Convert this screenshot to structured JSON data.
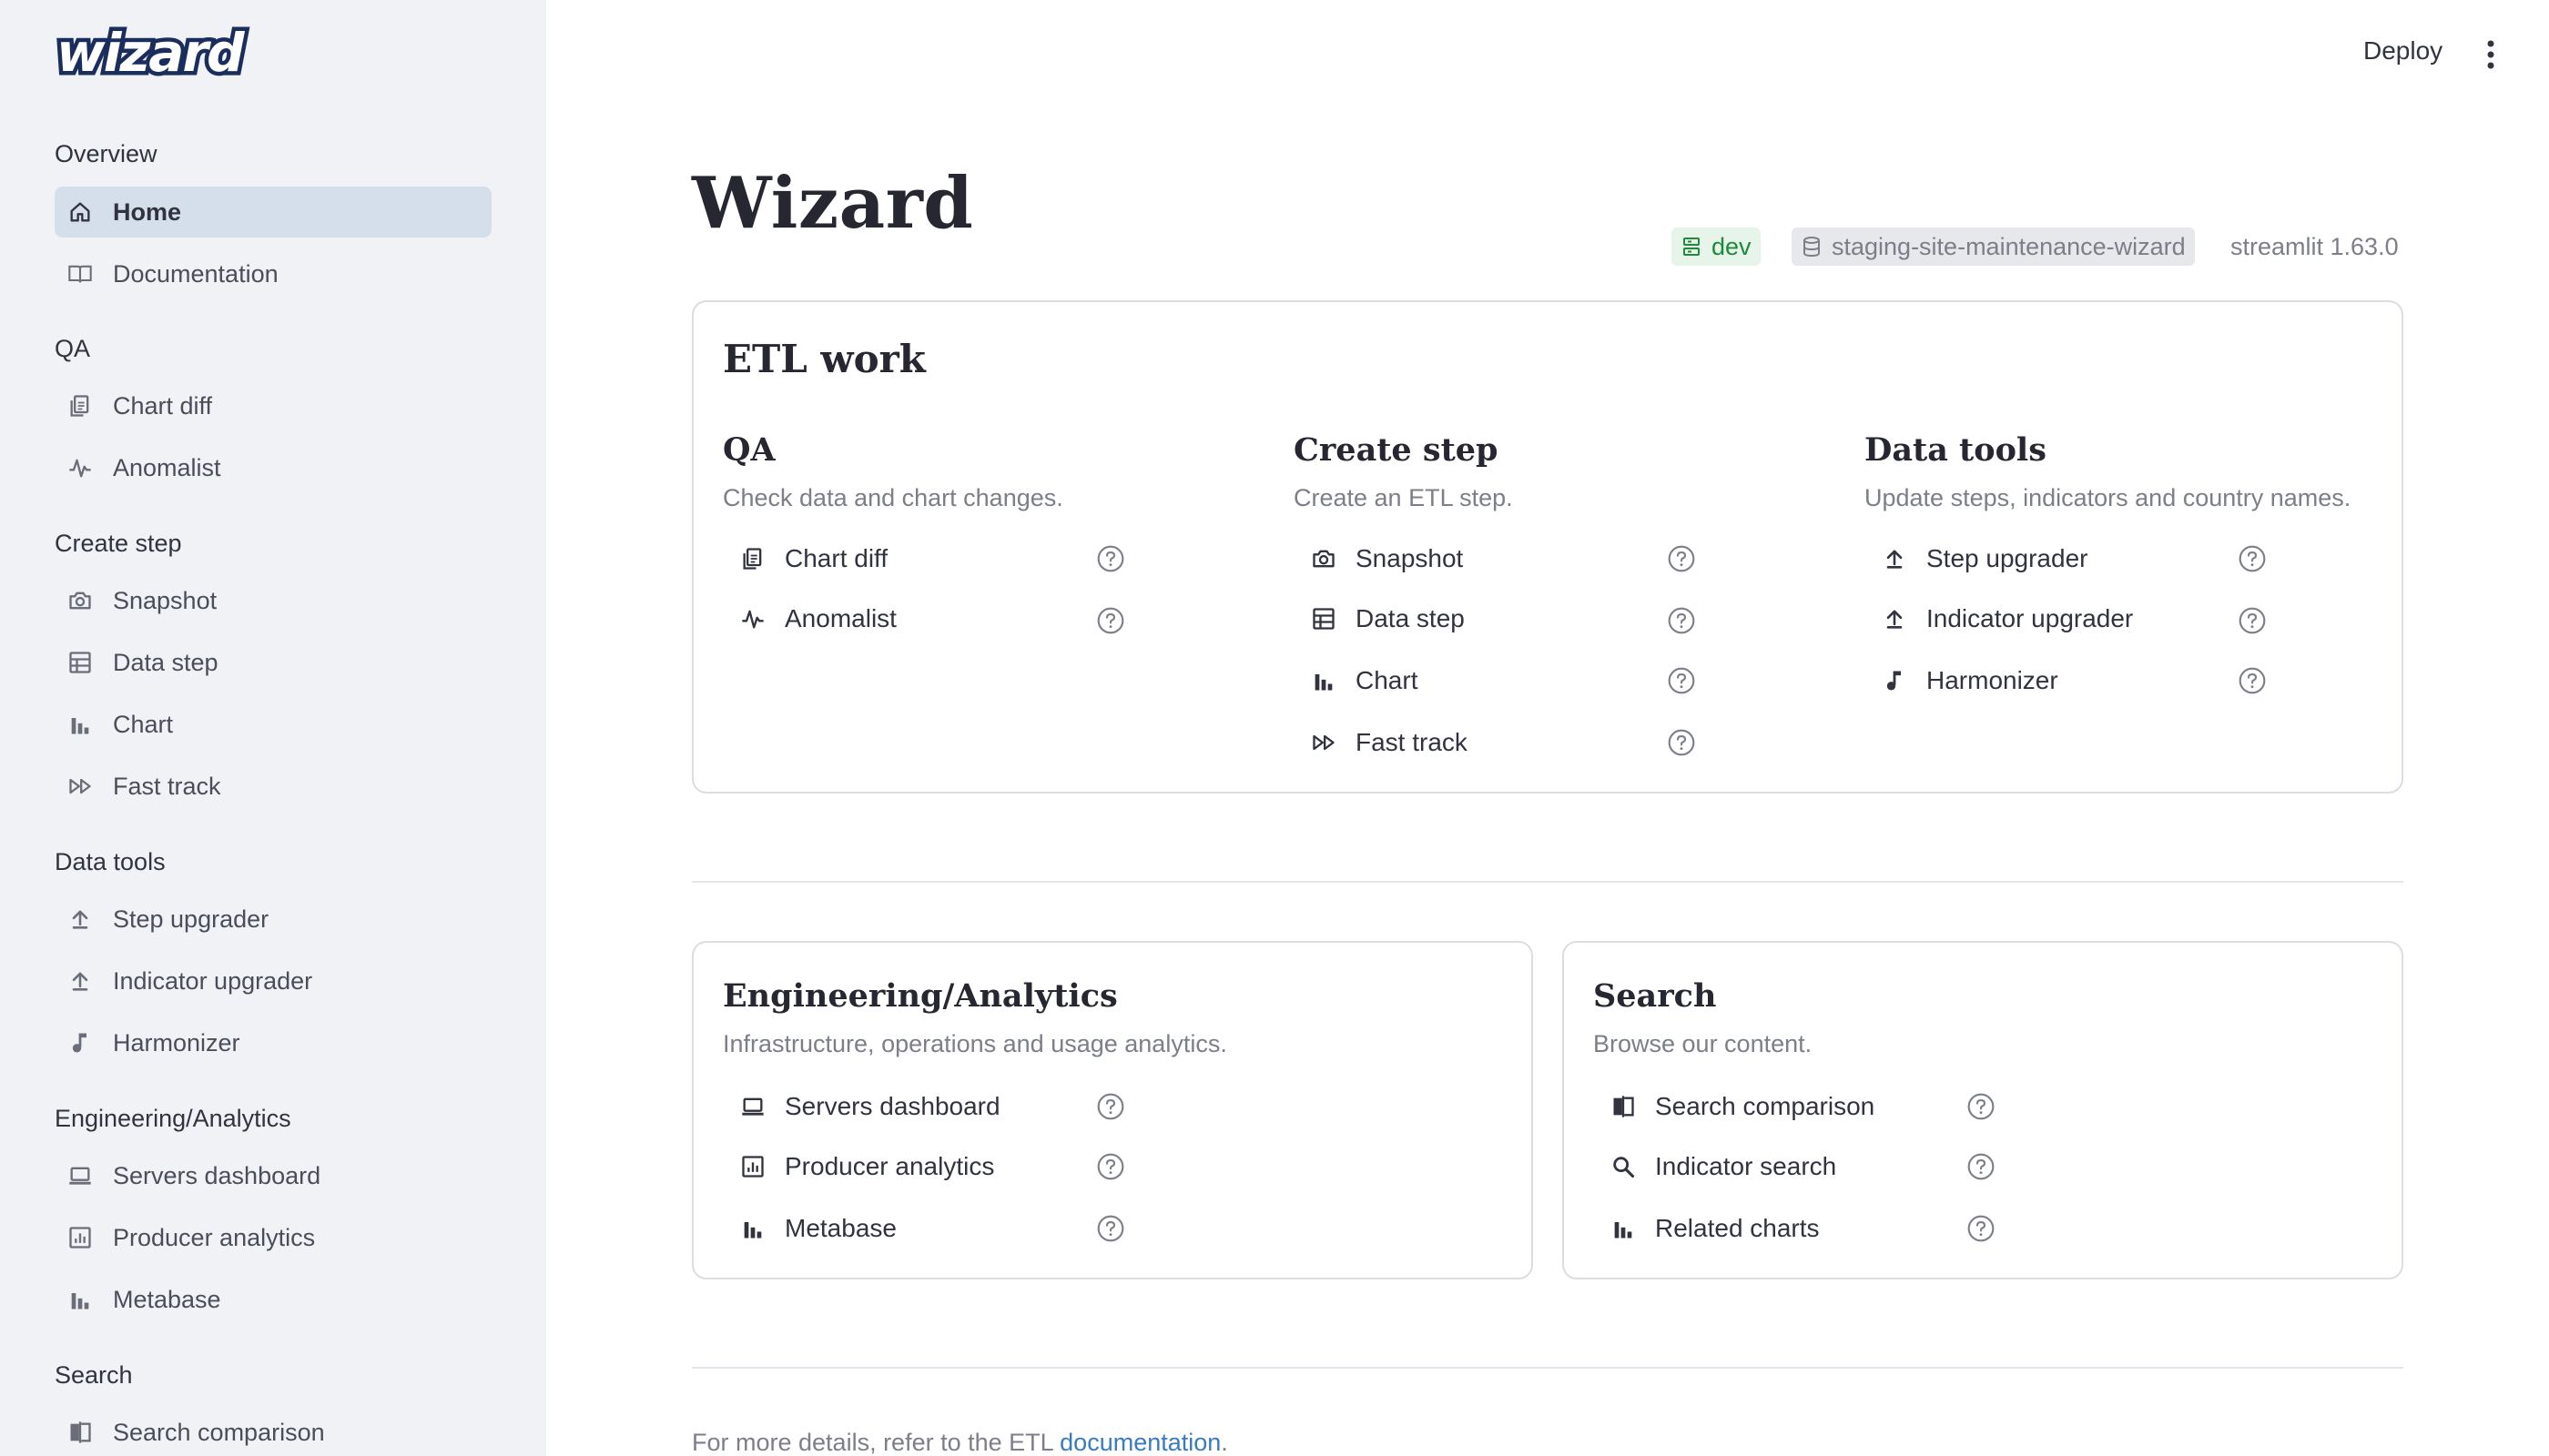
{
  "app": {
    "logo_text": "wizard"
  },
  "header": {
    "deploy_label": "Deploy"
  },
  "sidebar": {
    "groups": [
      {
        "label": "Overview",
        "items": [
          {
            "label": "Home",
            "icon": "home-icon",
            "active": true
          },
          {
            "label": "Documentation",
            "icon": "book-icon"
          }
        ]
      },
      {
        "label": "QA",
        "items": [
          {
            "label": "Chart diff",
            "icon": "document-copy-icon"
          },
          {
            "label": "Anomalist",
            "icon": "pulse-icon"
          }
        ]
      },
      {
        "label": "Create step",
        "items": [
          {
            "label": "Snapshot",
            "icon": "camera-icon"
          },
          {
            "label": "Data step",
            "icon": "table-icon"
          },
          {
            "label": "Chart",
            "icon": "bar-chart-icon"
          },
          {
            "label": "Fast track",
            "icon": "fast-forward-icon"
          }
        ]
      },
      {
        "label": "Data tools",
        "items": [
          {
            "label": "Step upgrader",
            "icon": "upload-icon"
          },
          {
            "label": "Indicator upgrader",
            "icon": "upload-icon"
          },
          {
            "label": "Harmonizer",
            "icon": "music-note-icon"
          }
        ]
      },
      {
        "label": "Engineering/Analytics",
        "items": [
          {
            "label": "Servers dashboard",
            "icon": "laptop-icon"
          },
          {
            "label": "Producer analytics",
            "icon": "analytics-icon"
          },
          {
            "label": "Metabase",
            "icon": "bar-chart-icon"
          }
        ]
      },
      {
        "label": "Search",
        "items": [
          {
            "label": "Search comparison",
            "icon": "compare-icon"
          }
        ]
      }
    ]
  },
  "main": {
    "title": "Wizard",
    "badges": {
      "env": "dev",
      "site": "staging-site-maintenance-wizard"
    },
    "version": "streamlit 1.63.0",
    "etl_card": {
      "title": "ETL work",
      "sections": [
        {
          "title": "QA",
          "description": "Check data and chart changes.",
          "links": [
            {
              "label": "Chart diff",
              "icon": "document-copy-icon"
            },
            {
              "label": "Anomalist",
              "icon": "pulse-icon"
            }
          ]
        },
        {
          "title": "Create step",
          "description": "Create an ETL step.",
          "links": [
            {
              "label": "Snapshot",
              "icon": "camera-icon"
            },
            {
              "label": "Data step",
              "icon": "table-icon"
            },
            {
              "label": "Chart",
              "icon": "bar-chart-icon"
            },
            {
              "label": "Fast track",
              "icon": "fast-forward-icon"
            }
          ]
        },
        {
          "title": "Data tools",
          "description": "Update steps, indicators and country names.",
          "links": [
            {
              "label": "Step upgrader",
              "icon": "upload-icon"
            },
            {
              "label": "Indicator upgrader",
              "icon": "upload-icon"
            },
            {
              "label": "Harmonizer",
              "icon": "music-note-icon"
            }
          ]
        }
      ]
    },
    "eng_card": {
      "title": "Engineering/Analytics",
      "description": "Infrastructure, operations and usage analytics.",
      "links": [
        {
          "label": "Servers dashboard",
          "icon": "laptop-icon"
        },
        {
          "label": "Producer analytics",
          "icon": "analytics-icon"
        },
        {
          "label": "Metabase",
          "icon": "bar-chart-icon"
        }
      ]
    },
    "search_card": {
      "title": "Search",
      "description": "Browse our content.",
      "links": [
        {
          "label": "Search comparison",
          "icon": "compare-icon"
        },
        {
          "label": "Indicator search",
          "icon": "search-icon"
        },
        {
          "label": "Related charts",
          "icon": "bar-chart-icon"
        }
      ]
    },
    "footer": {
      "prefix": "For more details, refer to the ETL ",
      "link": "documentation",
      "suffix": "."
    }
  },
  "colors": {
    "sidebar_bg": "#f0f2f6",
    "active_item_bg": "#d5deeb",
    "dev_badge": "#1e8a3a",
    "link": "#3a7bbf"
  }
}
